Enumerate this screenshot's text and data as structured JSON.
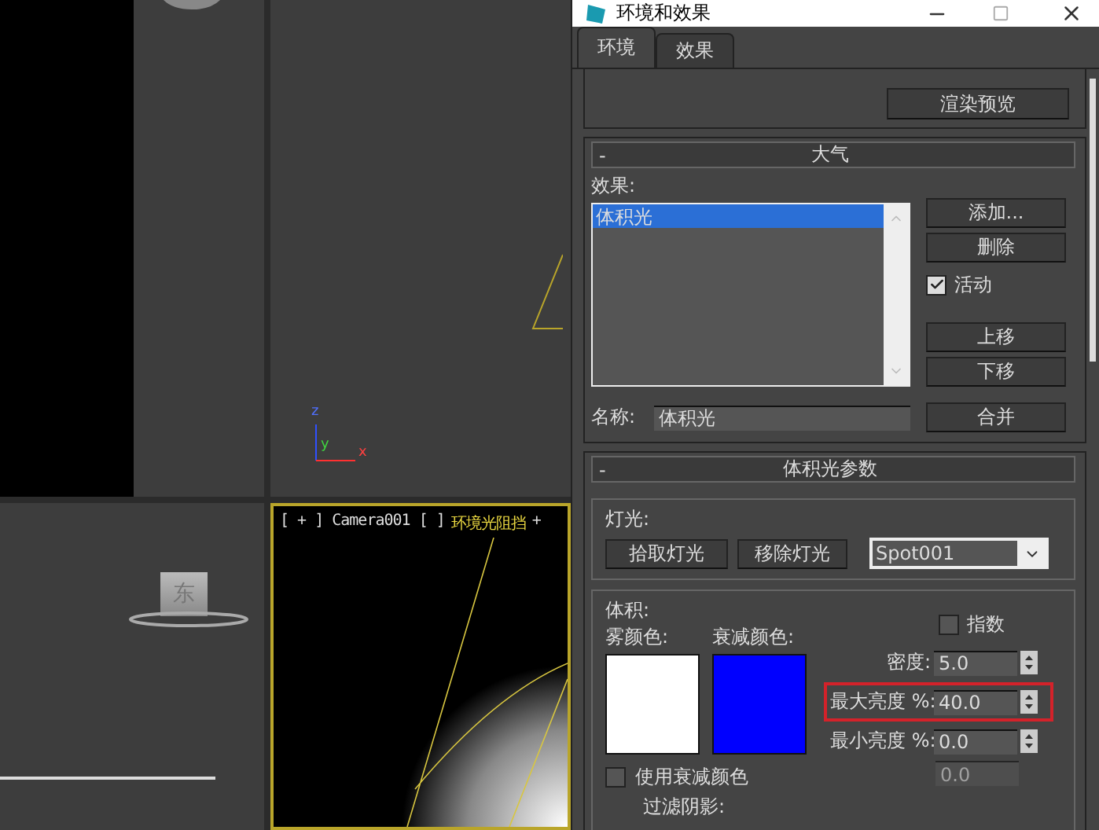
{
  "viewports": {
    "top_right": {
      "axis_labels": [
        "z",
        "y",
        "x"
      ]
    },
    "bottom_left": {
      "view_cube_label": "东"
    },
    "camera": {
      "menu": "[ + ] Camera001 [ ]",
      "shading": "环境光阻挡",
      "plus": "+"
    }
  },
  "dialog": {
    "title": "环境和效果",
    "tabs": [
      {
        "label": "环境",
        "selected": true
      },
      {
        "label": "效果",
        "selected": false
      }
    ],
    "render_preview_button": "渲染预览",
    "atmosphere": {
      "collapse": "-",
      "title": "大气",
      "effects_label": "效果:",
      "effects": [
        {
          "label": "体积光",
          "selected": true
        }
      ],
      "add_button": "添加...",
      "delete_button": "删除",
      "active": {
        "label": "活动",
        "checked": true
      },
      "move_up_button": "上移",
      "move_down_button": "下移",
      "name_label": "名称:",
      "name_value": "体积光",
      "merge_button": "合并"
    },
    "volume_light": {
      "collapse": "-",
      "title": "体积光参数",
      "lights": {
        "label": "灯光:",
        "pick_button": "拾取灯光",
        "remove_button": "移除灯光",
        "light_value": "Spot001"
      },
      "volume": {
        "label": "体积:",
        "swatches": [
          {
            "label": "雾颜色:",
            "color": "#ffffff"
          },
          {
            "label": "衰减颜色:",
            "color": "#0000ff"
          }
        ],
        "exponential": {
          "label": "指数",
          "checked": false
        },
        "spinners": [
          {
            "label": "密度:",
            "value": "5.0",
            "highlighted": false
          },
          {
            "label": "最大亮度 %:",
            "value": "40.0",
            "highlighted": true
          },
          {
            "label": "最小亮度 %:",
            "value": "0.0",
            "highlighted": false
          }
        ],
        "partial_value": "0.0",
        "use_attenuation": {
          "label": "使用衰减颜色",
          "checked": false
        },
        "filter_shadows_label": "过滤阴影:"
      }
    }
  }
}
